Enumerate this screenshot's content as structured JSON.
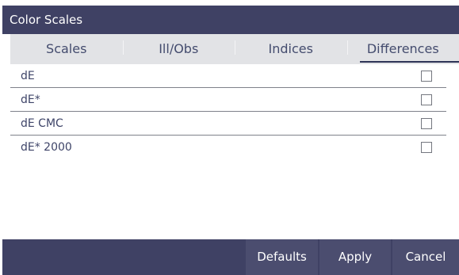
{
  "dialog": {
    "title": "Color Scales"
  },
  "tabs": [
    {
      "label": "Scales",
      "active": false
    },
    {
      "label": "Ill/Obs",
      "active": false
    },
    {
      "label": "Indices",
      "active": false
    },
    {
      "label": "Differences",
      "active": true
    }
  ],
  "rows": [
    {
      "label": "dE",
      "checked": false
    },
    {
      "label": "dE*",
      "checked": false
    },
    {
      "label": "dE CMC",
      "checked": false
    },
    {
      "label": "dE* 2000",
      "checked": false
    }
  ],
  "footer": {
    "defaults_label": "Defaults",
    "apply_label": "Apply",
    "cancel_label": "Cancel"
  },
  "colors": {
    "header_bg": "#3f4164",
    "tab_bg": "#e2e3e6",
    "text": "#3e4468"
  }
}
